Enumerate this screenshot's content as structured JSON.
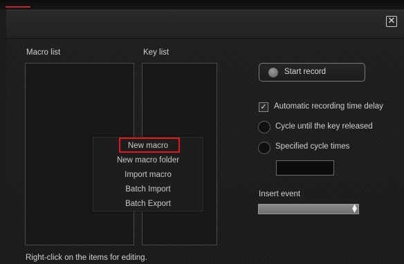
{
  "window": {
    "close_icon": "close-icon"
  },
  "lists": {
    "macro_list_label": "Macro list",
    "key_list_label": "Key list"
  },
  "context_menu": {
    "items": [
      {
        "label": "New macro"
      },
      {
        "label": "New macro folder"
      },
      {
        "label": "Import macro"
      },
      {
        "label": "Batch Import"
      },
      {
        "label": "Batch Export"
      }
    ]
  },
  "record": {
    "start_label": "Start record"
  },
  "options": {
    "auto_delay_label": "Automatic recording time delay",
    "auto_delay_checked": true,
    "cycle_until_release_label": "Cycle until the key released",
    "specified_cycle_label": "Specified cycle times",
    "cycle_times_value": ""
  },
  "insert_event": {
    "label": "Insert event",
    "selected": ""
  },
  "footer": {
    "hint": "Right-click on the items for editing."
  },
  "colors": {
    "accent": "#c0262c",
    "highlight": "#e0171c"
  }
}
